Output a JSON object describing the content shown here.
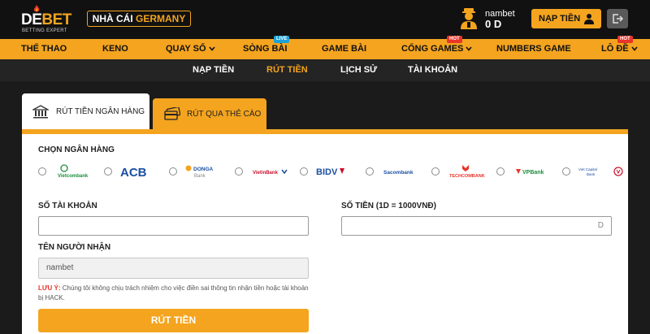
{
  "header": {
    "logo": {
      "part1": "DE",
      "part2": "BET",
      "subtitle": "BETTING EXPERT"
    },
    "market": {
      "prefix": "NHÀ CÁI",
      "country": "GERMANY"
    },
    "user": {
      "name": "nambet",
      "balance": "0 D"
    },
    "deposit_label": "NẠP TIỀN",
    "icons": {
      "user": "user-icon",
      "deposit": "wallet-icon",
      "logout": "logout-icon"
    }
  },
  "main_nav": [
    {
      "label": "THỂ THAO"
    },
    {
      "label": "KENO"
    },
    {
      "label": "QUAY SỐ"
    },
    {
      "label": "SÒNG BÀI",
      "badge": "LIVE"
    },
    {
      "label": "GAME BÀI"
    },
    {
      "label": "CỔNG GAMES",
      "badge": "HOT"
    },
    {
      "label": "NUMBERS GAME"
    },
    {
      "label": "LÔ ĐỀ",
      "badge": "HOT"
    }
  ],
  "sub_nav": [
    {
      "label": "NẠP TIỀN"
    },
    {
      "label": "RÚT TIỀN",
      "active": true
    },
    {
      "label": "LỊCH SỬ"
    },
    {
      "label": "TÀI KHOẢN"
    }
  ],
  "tabs": [
    {
      "label": "RÚT TIỀN NGÂN HÀNG",
      "icon": "bank-icon",
      "active": true
    },
    {
      "label": "RÚT QUA THẺ CÀO",
      "icon": "card-icon"
    }
  ],
  "form": {
    "bank_label": "CHỌN NGÂN HÀNG",
    "banks": [
      {
        "name": "Vietcombank"
      },
      {
        "name": "ACB"
      },
      {
        "name": "DONGA",
        "sub": "Bank"
      },
      {
        "name": "VietinBank"
      },
      {
        "name": "BIDV"
      },
      {
        "name": "Sacombank"
      },
      {
        "name": "TECHCOMBANK"
      },
      {
        "name": "VPBank"
      },
      {
        "name": "Viet Capital",
        "sub": "Bank"
      }
    ],
    "account_label": "SỐ TÀI KHOẢN",
    "account_value": "",
    "amount_label": "SỐ TIỀN (1D = 1000VNĐ)",
    "amount_value": "",
    "amount_suffix": "D",
    "receiver_label": "TÊN NGƯỜI NHẬN",
    "receiver_value": "nambet",
    "warning_label": "LƯU Ý:",
    "warning_text": "Chúng tôi không chịu trách nhiệm cho việc điền sai thông tin nhận tiền hoặc tài khoản bị HACK.",
    "submit_label": "RÚT TIỀN"
  },
  "colors": {
    "accent": "#f4a41f",
    "header_bg": "#111111",
    "subnav_bg": "#242424",
    "hot": "#e8342a",
    "live": "#1aa3d8"
  }
}
